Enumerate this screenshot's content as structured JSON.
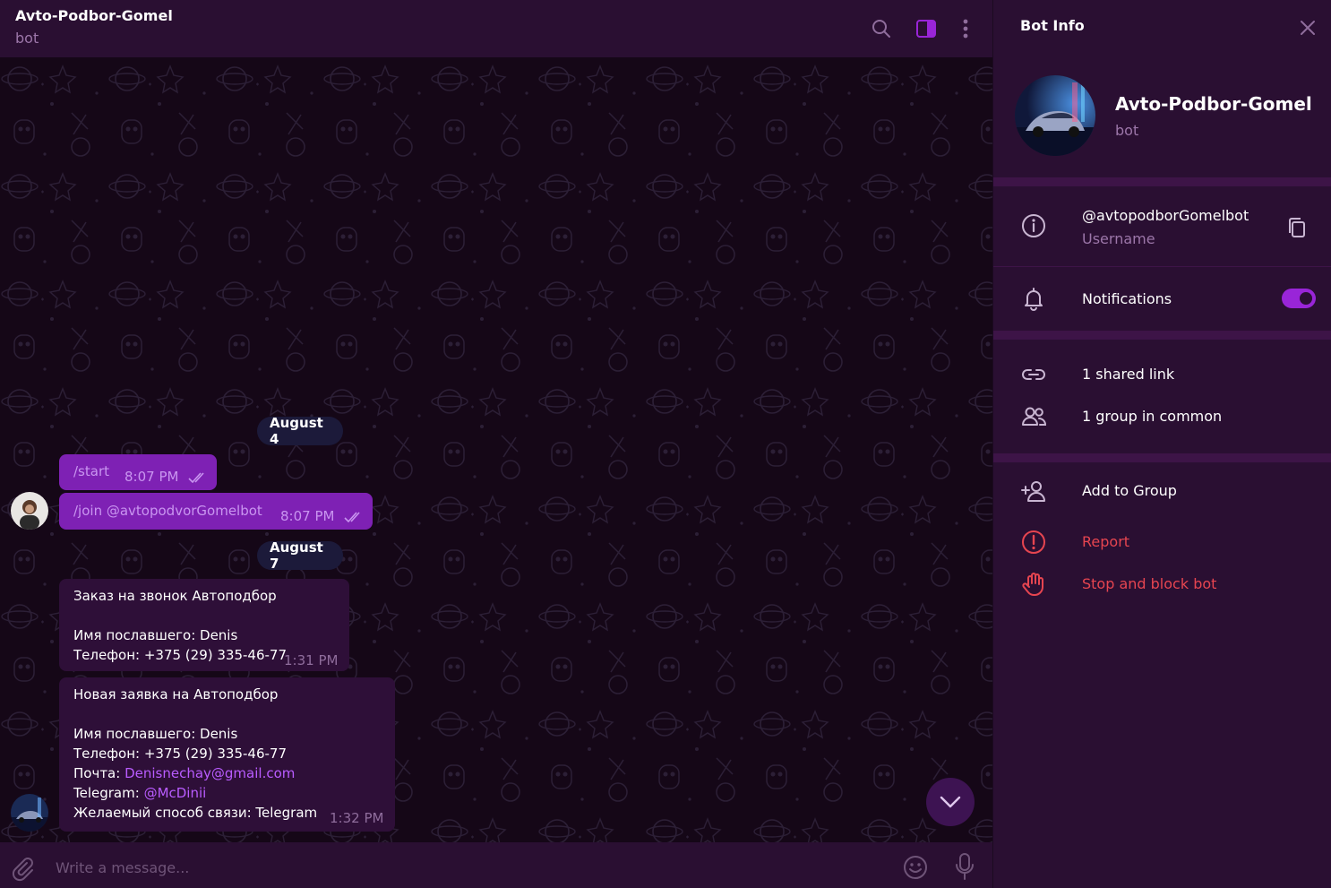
{
  "chat": {
    "title": "Avto-Podbor-Gomel",
    "subtitle": "bot",
    "header_icons": [
      "search-icon",
      "sidebar-toggle-icon",
      "more-vertical-icon"
    ],
    "dates": [
      "August 4",
      "August 7"
    ],
    "messages_out": [
      {
        "text": "/start",
        "time": "8:07 PM",
        "status": "read"
      },
      {
        "text": "/join @avtopodvorGomelbot",
        "time": "8:07 PM",
        "status": "read"
      }
    ],
    "message_in_1": {
      "line1": "Заказ на звонок Автоподбор",
      "line2": "Имя пославшего: Denis",
      "line3": "Телефон: +375 (29) 335-46-77",
      "time": "1:31 PM"
    },
    "message_in_2": {
      "line1": "Новая заявка на Автоподбор",
      "line2": "Имя пославшего: Denis",
      "line3": "Телефон: +375 (29) 335-46-77",
      "email_label": "Почта: ",
      "email": "Denisnechay@gmail.com",
      "telegram_label": "Telegram: ",
      "telegram": "@McDinii",
      "line6": "Желаемый способ связи: Telegram",
      "time": "1:32 PM"
    },
    "composer_placeholder": "Write a message..."
  },
  "panel": {
    "title": "Bot Info",
    "name": "Avto-Podbor-Gomel",
    "subtitle": "bot",
    "username": "@avtopodborGomelbot",
    "username_label": "Username",
    "notifications_label": "Notifications",
    "notifications_on": true,
    "shared_links": "1 shared link",
    "groups_common": "1 group in common",
    "add_to_group": "Add to Group",
    "report": "Report",
    "stop_block": "Stop and block bot"
  },
  "colors": {
    "accent": "#9925d8",
    "outgoing_bubble": "#7e21b4",
    "incoming_bubble": "#2e0f38",
    "header": "#2a0f32",
    "danger": "#e64550",
    "link": "#b95cff",
    "muted": "#9c76a9"
  }
}
